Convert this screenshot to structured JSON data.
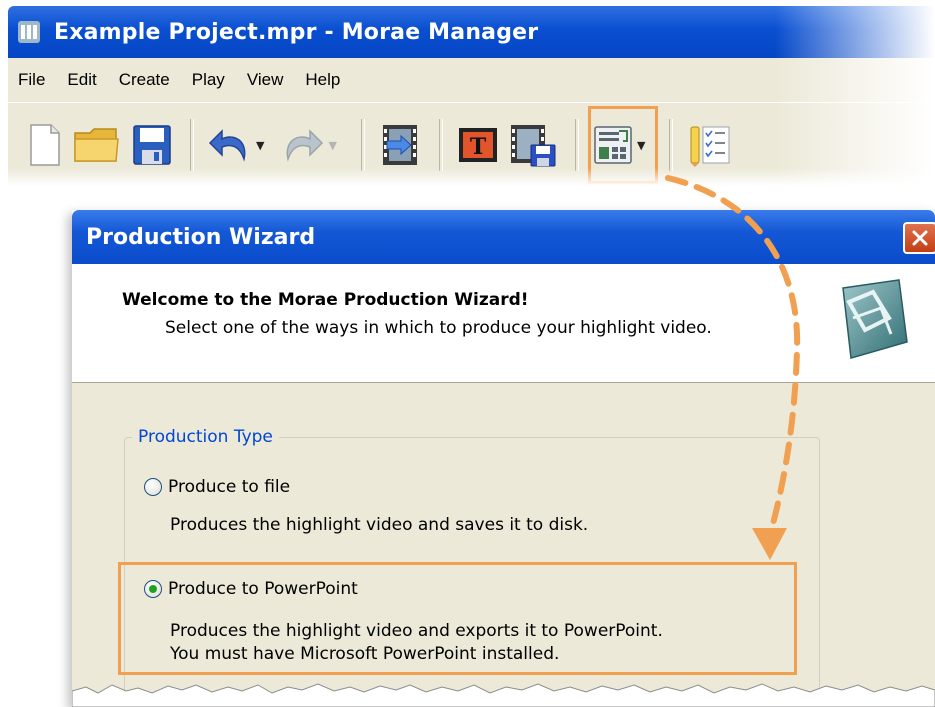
{
  "main_window": {
    "title": "Example Project.mpr - Morae Manager",
    "menu": [
      "File",
      "Edit",
      "Create",
      "Play",
      "View",
      "Help"
    ],
    "toolbar": {
      "buttons": [
        "new-document-icon",
        "open-folder-icon",
        "save-icon",
        "undo-icon",
        "redo-icon",
        "import-video-icon",
        "title-clip-icon",
        "produce-video-icon",
        "layout-icon",
        "task-list-icon"
      ]
    }
  },
  "dialog": {
    "title": "Production Wizard",
    "heading": "Welcome to the Morae Production Wizard!",
    "subheading": "Select one of the ways in which to produce your highlight video.",
    "group_label": "Production Type",
    "options": [
      {
        "label": "Produce to file",
        "desc1": "Produces the highlight video and saves it to disk.",
        "desc2": "",
        "selected": false
      },
      {
        "label": "Produce to PowerPoint",
        "desc1": "Produces the highlight video and exports it to PowerPoint.",
        "desc2": "You must have Microsoft PowerPoint installed.",
        "selected": true
      }
    ]
  },
  "colors": {
    "callout": "#f0a050",
    "titlebar": "#0a4fd1",
    "dialog_bg": "#ece9d8",
    "group_label": "#0046d5"
  }
}
